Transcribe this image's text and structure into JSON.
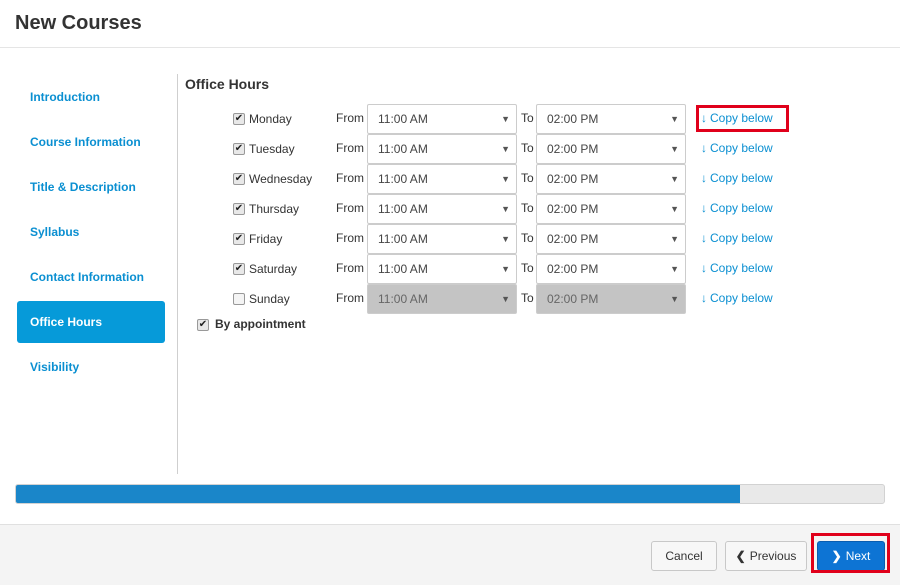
{
  "dialog": {
    "title": "New Courses"
  },
  "sidebar": {
    "items": [
      {
        "label": "Introduction"
      },
      {
        "label": "Course Information"
      },
      {
        "label": "Title & Description"
      },
      {
        "label": "Syllabus"
      },
      {
        "label": "Contact Information"
      },
      {
        "label": "Office Hours",
        "active": true
      },
      {
        "label": "Visibility"
      }
    ]
  },
  "office_hours": {
    "title": "Office Hours",
    "from_label": "From",
    "to_label": "To",
    "copy_label": "Copy below",
    "days": [
      {
        "day": "Monday",
        "checked": true,
        "from": "11:00 AM",
        "to": "02:00 PM"
      },
      {
        "day": "Tuesday",
        "checked": true,
        "from": "11:00 AM",
        "to": "02:00 PM"
      },
      {
        "day": "Wednesday",
        "checked": true,
        "from": "11:00 AM",
        "to": "02:00 PM"
      },
      {
        "day": "Thursday",
        "checked": true,
        "from": "11:00 AM",
        "to": "02:00 PM"
      },
      {
        "day": "Friday",
        "checked": true,
        "from": "11:00 AM",
        "to": "02:00 PM"
      },
      {
        "day": "Saturday",
        "checked": true,
        "from": "11:00 AM",
        "to": "02:00 PM"
      },
      {
        "day": "Sunday",
        "checked": false,
        "from": "11:00 AM",
        "to": "02:00 PM"
      }
    ],
    "by_appointment": {
      "label": "By appointment",
      "checked": true
    }
  },
  "progress": {
    "fraction": 0.834
  },
  "footer": {
    "cancel_label": "Cancel",
    "previous_label": "Previous",
    "next_label": "Next"
  },
  "colors": {
    "accent": "#069ad9",
    "link": "#0a8fd1",
    "progress": "#1a86c9",
    "primary_button": "#0d74d4",
    "highlight": "#e0001b"
  }
}
